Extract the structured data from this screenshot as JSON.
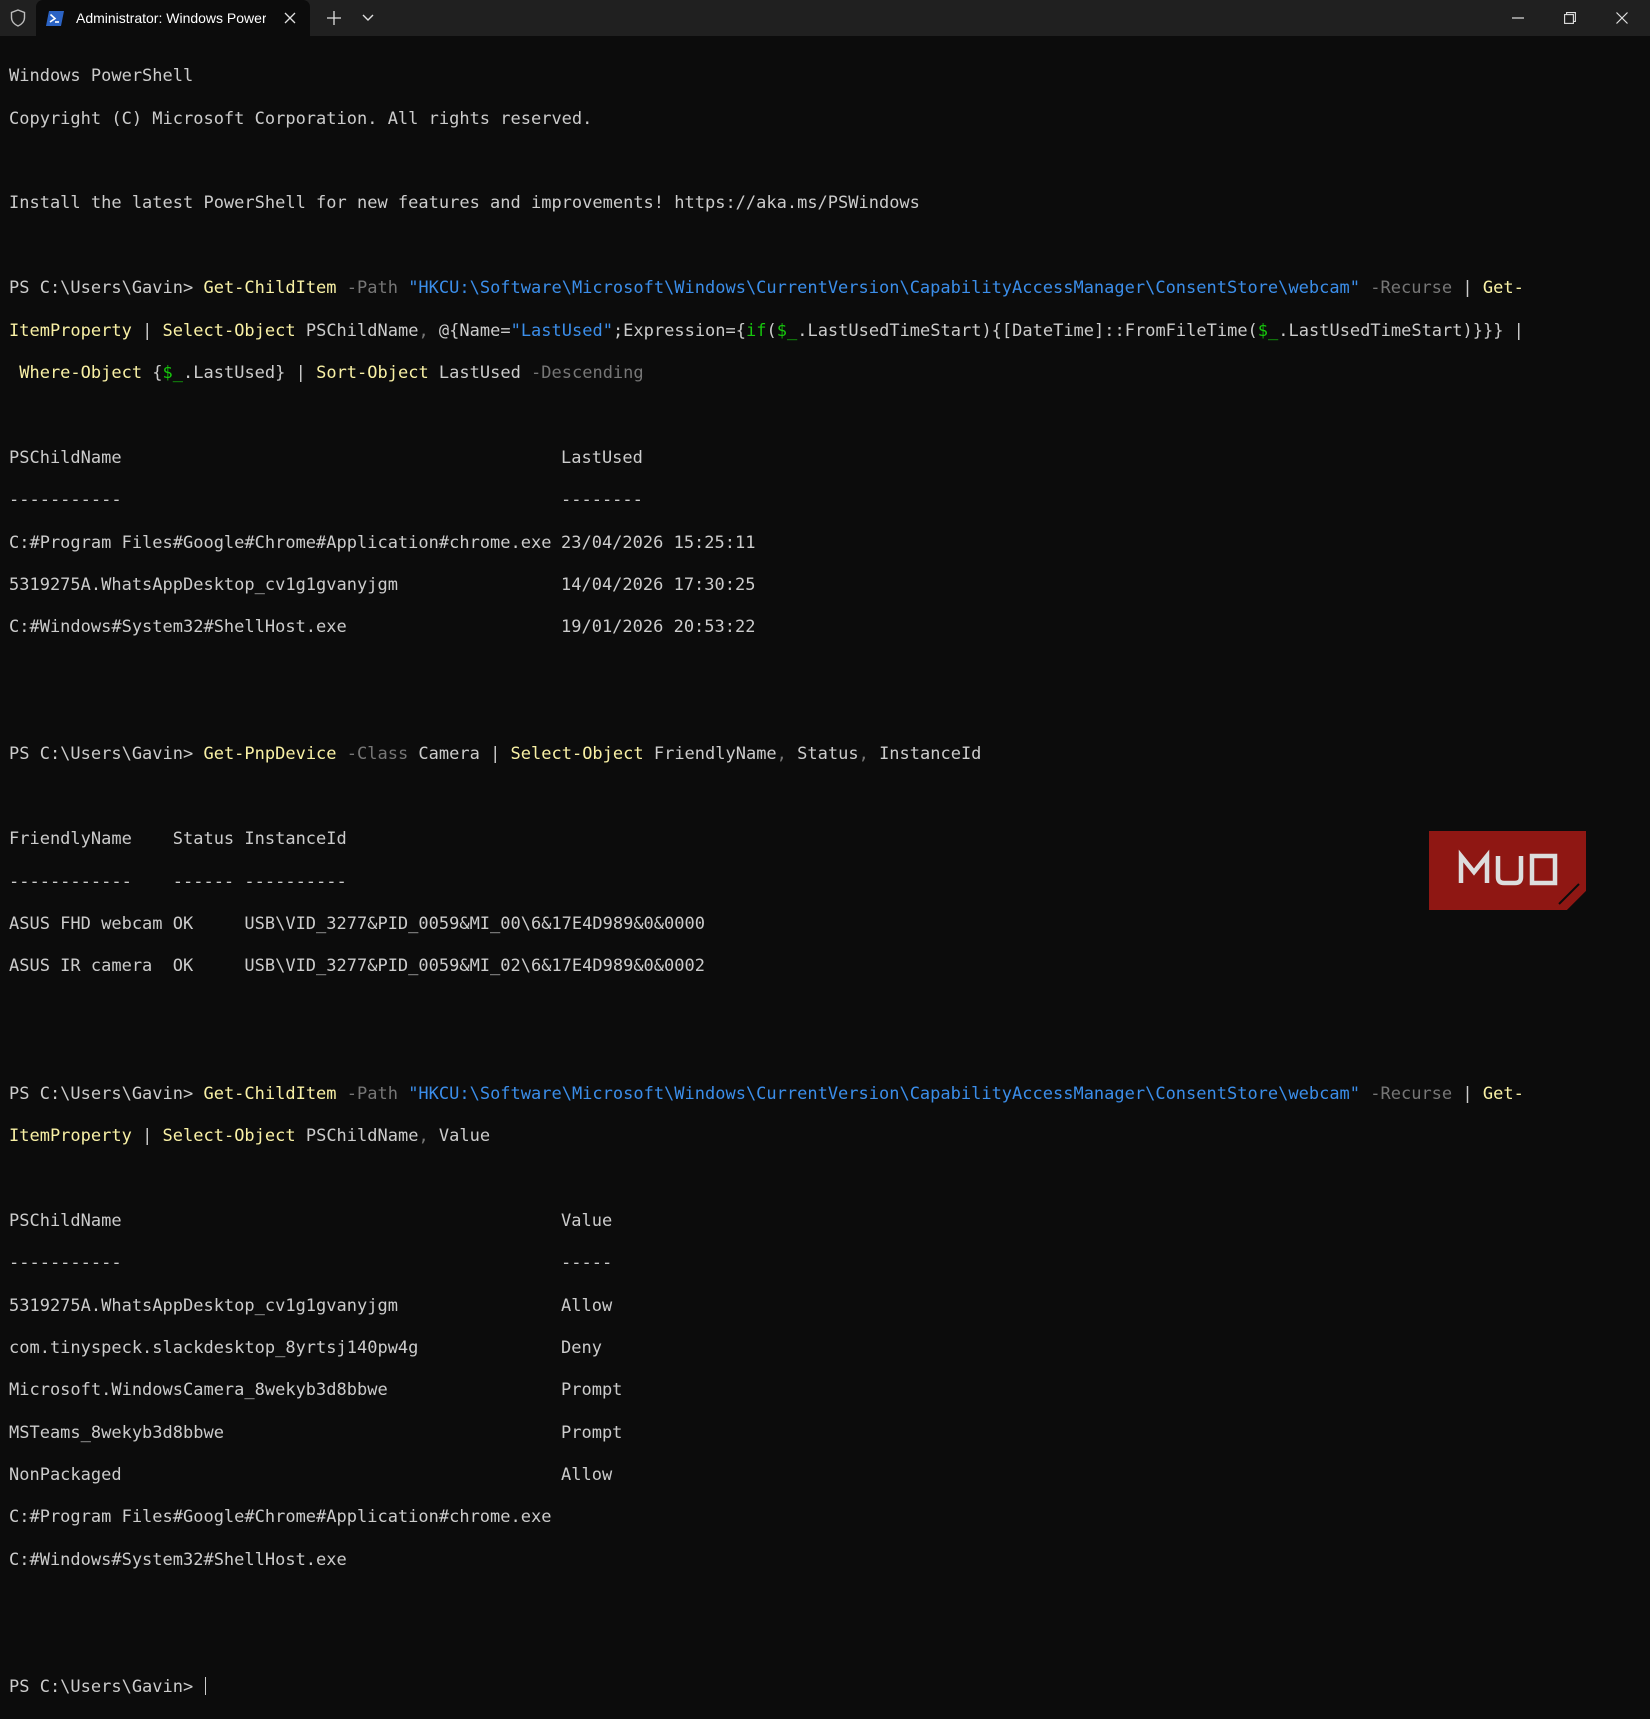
{
  "window": {
    "tab_title": "Administrator: Windows PowerShell",
    "icons": {
      "shield": "shield-icon",
      "powershell": "powershell-icon",
      "close_tab": "close-icon",
      "new_tab": "plus-icon",
      "dropdown": "chevron-down-icon",
      "minimize": "minimize-icon",
      "maximize": "maximize-icon",
      "close": "close-icon"
    }
  },
  "colors": {
    "background": "#0c0c0c",
    "foreground": "#cccccc",
    "command": "#f9f1a5",
    "string": "#3b8eea",
    "parameter": "#767676",
    "variable": "#16c60c"
  },
  "terminal": {
    "header1": "Windows PowerShell",
    "header2": "Copyright (C) Microsoft Corporation. All rights reserved.",
    "install_msg": "Install the latest PowerShell for new features and improvements! https://aka.ms/PSWindows",
    "prompt": "PS C:\\Users\\Gavin> ",
    "cmd1": {
      "get_childitem": "Get-ChildItem",
      "path_param": " -Path ",
      "path_value": "\"HKCU:\\Software\\Microsoft\\Windows\\CurrentVersion\\CapabilityAccessManager\\ConsentStore\\webcam\"",
      "recurse": " -Recurse",
      "pipe_get": " | ",
      "get_prefix": "Get-",
      "item_property": "ItemProperty",
      "pipe2": " | ",
      "select_object": "Select-Object",
      "select_args": " PSChildName",
      "comma": ", ",
      "hash_open": "@{Name=",
      "name_value": "\"LastUsed\"",
      "expr_open": ";Expression={",
      "if_kw": "if",
      "paren_open": "(",
      "var1": "$_",
      "prop1": ".LastUsedTimeStart){[DateTime]::FromFileTime(",
      "var2": "$_",
      "prop2": ".LastUsedTimeStart)}}} |",
      "where_object": " Where-Object",
      "where_open": " {",
      "var3": "$_",
      "where_prop": ".LastUsed} | ",
      "sort_object": "Sort-Object",
      "sort_arg": " LastUsed ",
      "descending": "-Descending"
    },
    "table1": {
      "headers": [
        "PSChildName",
        "LastUsed"
      ],
      "underlines": [
        "-----------",
        "--------"
      ],
      "rows": [
        [
          "C:#Program Files#Google#Chrome#Application#chrome.exe",
          "23/04/2026 15:25:11"
        ],
        [
          "5319275A.WhatsAppDesktop_cv1g1gvanyjgm",
          "14/04/2026 17:30:25"
        ],
        [
          "C:#Windows#System32#ShellHost.exe",
          "19/01/2026 20:53:22"
        ]
      ]
    },
    "cmd2": {
      "get_pnpdevice": "Get-PnpDevice",
      "class_param": " -Class",
      "class_value": " Camera | ",
      "select_object": "Select-Object",
      "args1": " FriendlyName",
      "comma1": ", ",
      "args2": "Status",
      "comma2": ", ",
      "args3": "InstanceId"
    },
    "table2": {
      "header": "FriendlyName    Status InstanceId",
      "underline": "------------    ------ ----------",
      "rows": [
        "ASUS FHD webcam OK     USB\\VID_3277&PID_0059&MI_00\\6&17E4D989&0&0000",
        "ASUS IR camera  OK     USB\\VID_3277&PID_0059&MI_02\\6&17E4D989&0&0002"
      ]
    },
    "cmd3": {
      "select_args": " PSChildName",
      "comma": ", ",
      "value_arg": "Value"
    },
    "table3": {
      "headers": [
        "PSChildName",
        "Value"
      ],
      "underlines": [
        "-----------",
        "-----"
      ],
      "rows": [
        [
          "5319275A.WhatsAppDesktop_cv1g1gvanyjgm",
          "Allow"
        ],
        [
          "com.tinyspeck.slackdesktop_8yrtsj140pw4g",
          "Deny"
        ],
        [
          "Microsoft.WindowsCamera_8wekyb3d8bbwe",
          "Prompt"
        ],
        [
          "MSTeams_8wekyb3d8bbwe",
          "Prompt"
        ],
        [
          "NonPackaged",
          "Allow"
        ],
        [
          "C:#Program Files#Google#Chrome#Application#chrome.exe",
          ""
        ],
        [
          "C:#Windows#System32#ShellHost.exe",
          ""
        ]
      ]
    }
  },
  "watermark": {
    "text": "MUO",
    "color": "#9e1b17"
  }
}
